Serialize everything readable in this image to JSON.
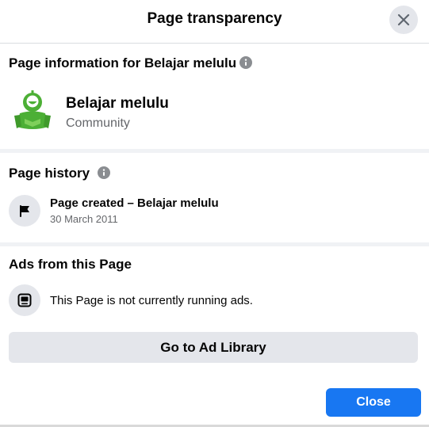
{
  "header": {
    "title": "Page transparency",
    "close_icon": "close-icon"
  },
  "page_info": {
    "title": "Page information for Belajar melulu",
    "info_icon": "info-icon",
    "page_name": "Belajar melulu",
    "category": "Community",
    "avatar_icon": "green-mascot-avatar"
  },
  "history": {
    "title": "Page history",
    "info_icon": "info-icon",
    "event_icon": "flag-icon",
    "event": "Page created – Belajar melulu",
    "date": "30 March 2011"
  },
  "ads": {
    "title": "Ads from this Page",
    "icon": "ad-tablet-icon",
    "status": "This Page is not currently running ads.",
    "library_button": "Go to Ad Library"
  },
  "footer": {
    "close_button": "Close"
  },
  "colors": {
    "primary": "#1877f2",
    "secondary_button": "#e4e6eb",
    "muted_text": "#65676b",
    "avatar_green": "#4caf35"
  }
}
